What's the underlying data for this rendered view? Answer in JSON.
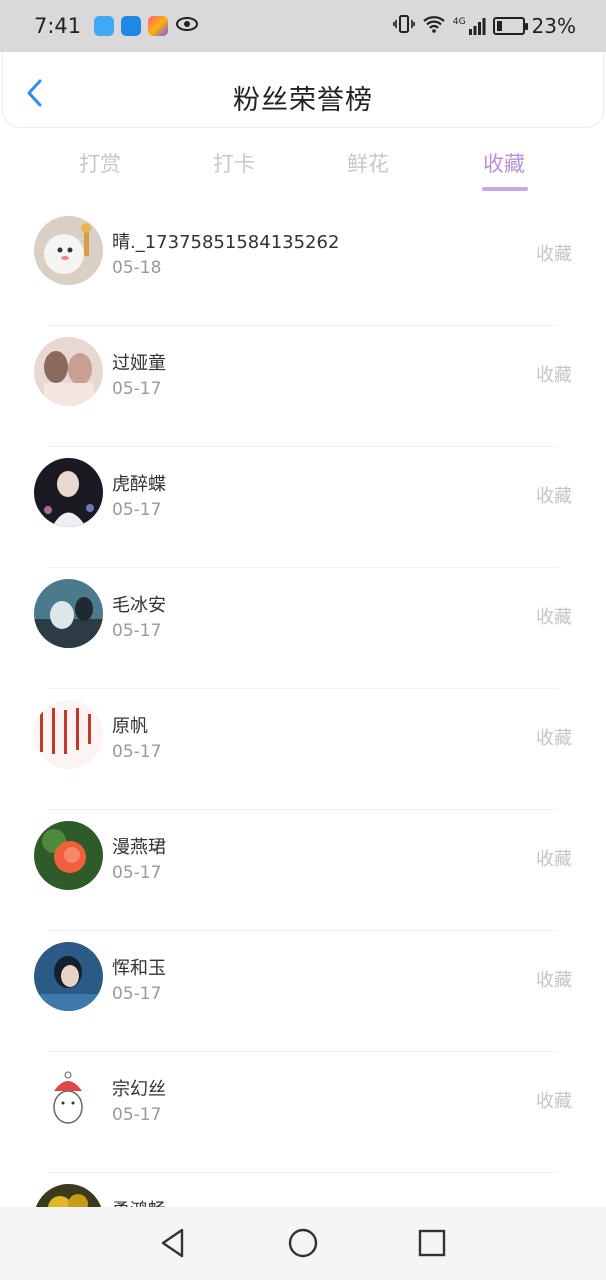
{
  "status_bar": {
    "time": "7:41",
    "network": "4G",
    "battery_percent": "23%",
    "battery_level": 0.23,
    "icons": [
      "app-icon-blue",
      "app-icon-cloud",
      "app-icon-colorful",
      "eye-icon",
      "vibrate-icon",
      "wifi-icon",
      "signal-icon",
      "battery-icon"
    ]
  },
  "header": {
    "back_icon": "chevron-left-icon",
    "title": "粉丝荣誉榜",
    "accent_color": "#2f8cf5"
  },
  "tabs": {
    "items": [
      {
        "label": "打赏"
      },
      {
        "label": "打卡"
      },
      {
        "label": "鲜花"
      },
      {
        "label": "收藏"
      }
    ],
    "active": "收藏",
    "active_color": "#b993d6"
  },
  "list": {
    "items": [
      {
        "name": "晴._17375851584135262",
        "date": "05-18",
        "action": "收藏"
      },
      {
        "name": "过娅童",
        "date": "05-17",
        "action": "收藏"
      },
      {
        "name": "虎醉蝶",
        "date": "05-17",
        "action": "收藏"
      },
      {
        "name": "毛冰安",
        "date": "05-17",
        "action": "收藏"
      },
      {
        "name": "原帆",
        "date": "05-17",
        "action": "收藏"
      },
      {
        "name": "漫燕珺",
        "date": "05-17",
        "action": "收藏"
      },
      {
        "name": "恽和玉",
        "date": "05-17",
        "action": "收藏"
      },
      {
        "name": "宗幻丝",
        "date": "05-17",
        "action": "收藏"
      },
      {
        "name": "勇鸿畅",
        "date": "",
        "action": ""
      }
    ]
  },
  "nav_bar": {
    "icons": [
      "back-triangle-icon",
      "home-circle-icon",
      "recents-square-icon"
    ]
  }
}
